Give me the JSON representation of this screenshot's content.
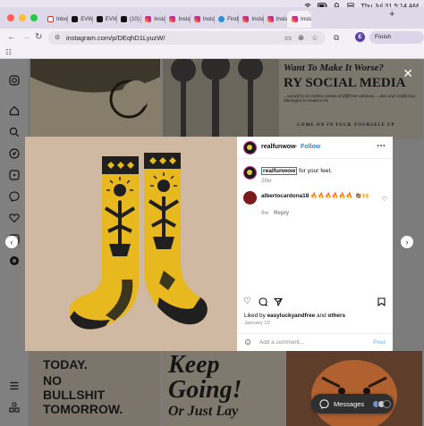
{
  "menubar": {
    "datetime": "Thu Jul 31  5:14 AM"
  },
  "tabs": [
    {
      "label": "Inbo",
      "favicon": "gmail-icon",
      "active": false
    },
    {
      "label": "EVW",
      "favicon": "x-icon",
      "active": false
    },
    {
      "label": "EVW",
      "favicon": "x-icon",
      "active": false
    },
    {
      "label": "(10)",
      "favicon": "x-icon",
      "active": false
    },
    {
      "label": "Insta",
      "favicon": "instagram-icon",
      "active": false
    },
    {
      "label": "Insta",
      "favicon": "instagram-icon",
      "active": false
    },
    {
      "label": "Insta",
      "favicon": "instagram-icon",
      "active": false
    },
    {
      "label": "Find",
      "favicon": "finder-icon",
      "active": false
    },
    {
      "label": "Insta",
      "favicon": "instagram-icon",
      "active": false
    },
    {
      "label": "Insta",
      "favicon": "instagram-icon",
      "active": false
    },
    {
      "label": "Insta",
      "favicon": "instagram-icon",
      "active": true
    }
  ],
  "toolbar": {
    "url": "instagram.com/p/DEqhD1LyuzW/",
    "finish_update": "Finish update",
    "profile_initial": "E"
  },
  "background_posters": {
    "top_right_line1": "Want To Make It Worse?",
    "top_right_line2": "RY SOCIAL MEDIA",
    "top_right_body": "...ourself to an endless stream of different opinions, ...ates and conflicting ideologies is bound to be",
    "top_right_footer": "COME ON IN FUCK YOURSELF UP",
    "bottom_left": [
      "TODAY.",
      "NO",
      "BULLSHIT",
      "TOMORROW."
    ],
    "bottom_mid": [
      "Keep",
      "Going!",
      "Or Just Lay"
    ]
  },
  "post": {
    "username": "realfunwow",
    "follow": "Follow",
    "caption_user": "realfunwow",
    "caption_text": "for your feet.",
    "caption_age": "28w",
    "comment": {
      "username": "albertocardona18",
      "text": "🔥🔥🔥🔥🔥🔥 👏🏽🙌",
      "age": "9w",
      "reply": "Reply"
    },
    "likes_prefix": "Liked by",
    "likes_user": "easyluckyandfree",
    "likes_and": "and",
    "likes_others": "others",
    "date": "January 10",
    "comment_placeholder": "Add a comment...",
    "post_button": "Post"
  },
  "messages": {
    "label": "Messages"
  },
  "colors": {
    "instagram_blue": "#0095f6",
    "sock_yellow": "#e8b81f",
    "photo_bg": "#cfb9a3"
  }
}
